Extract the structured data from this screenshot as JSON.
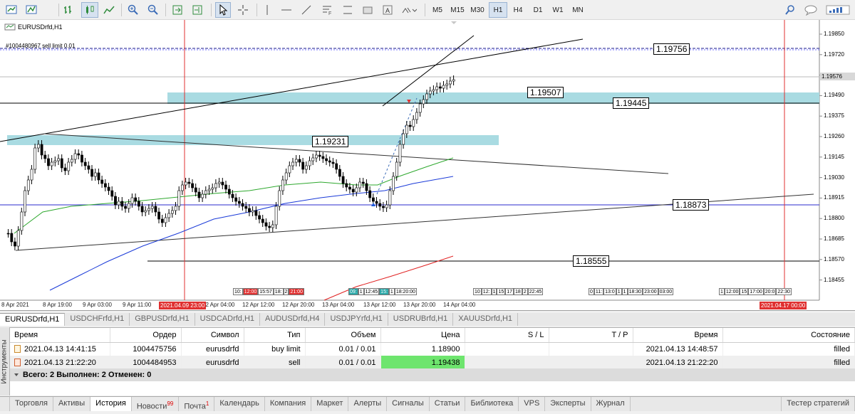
{
  "toolbar": {
    "timeframes": [
      "M5",
      "M15",
      "M30",
      "H1",
      "H4",
      "D1",
      "W1",
      "MN"
    ],
    "active_timeframe": "H1"
  },
  "chart": {
    "title": "EURUSDrfd,H1",
    "order_label": "#1004480967 sell limit 0.01",
    "price_ticks": [
      "1.19850",
      "1.19720",
      "1.19600",
      "1.19490",
      "1.19375",
      "1.19260",
      "1.19145",
      "1.19030",
      "1.18915",
      "1.18800",
      "1.18685",
      "1.18570",
      "1.18455"
    ],
    "current_price": "1.19576",
    "level_labels": [
      "1.19756",
      "1.19507",
      "1.19445",
      "1.19231",
      "1.18873",
      "1.18555"
    ],
    "time_ticks": [
      "8 Apr 2021",
      "8 Apr 19:00",
      "9 Apr 03:00",
      "9 Apr 11:00",
      "12 Apr 04:00",
      "12 Apr 12:00",
      "12 Apr 20:00",
      "13 Apr 04:00",
      "13 Apr 12:00",
      "13 Apr 20:00",
      "14 Apr 04:00"
    ],
    "vline_left_label": "2021.04.09 23:00",
    "vline_right_label": "2021.04.17 00:00",
    "mini_groups": [
      [
        "10:",
        "12:00",
        "15:57",
        "18:",
        "2",
        "21:00"
      ],
      [
        "09:",
        "1",
        "12:45",
        "15:",
        "1",
        "18:20:00"
      ],
      [
        "10",
        "12:",
        "1",
        "15",
        "17",
        "18",
        "2",
        "22:45"
      ],
      [
        "0",
        "11:",
        "13:0",
        "1",
        "1",
        "18:30",
        "23:00",
        "03:00"
      ],
      [
        "1",
        "12:00",
        "15",
        "17:00",
        "20:0",
        "22:30"
      ]
    ]
  },
  "symbol_tabs": [
    "EURUSDrfd,H1",
    "USDCHFrfd,H1",
    "GBPUSDrfd,H1",
    "USDCADrfd,H1",
    "AUDUSDrfd,H4",
    "USDJPYrfd,H1",
    "USDRUBrfd,H1",
    "XAUUSDrfd,H1"
  ],
  "panel": {
    "side_label": "Инструменты",
    "columns": [
      "Время",
      "Ордер",
      "Символ",
      "Тип",
      "Объем",
      "Цена",
      "S / L",
      "T / P",
      "Время",
      "Состояние"
    ],
    "rows": [
      [
        "2021.04.13 14:41:15",
        "1004475756",
        "eurusdrfd",
        "buy limit",
        "0.01 / 0.01",
        "1.18900",
        "",
        "",
        "2021.04.13 14:48:57",
        "filled"
      ],
      [
        "2021.04.13 21:22:20",
        "1004484953",
        "eurusdrfd",
        "sell",
        "0.01 / 0.01",
        "1.19438",
        "",
        "",
        "2021.04.13 21:22:20",
        "filled"
      ]
    ],
    "summary": "Всего: 2  Выполнен: 2  Отменен: 0"
  },
  "bottom_tabs": [
    {
      "label": "Торговля",
      "badge": ""
    },
    {
      "label": "Активы",
      "badge": ""
    },
    {
      "label": "История",
      "badge": ""
    },
    {
      "label": "Новости",
      "badge": "99"
    },
    {
      "label": "Почта",
      "badge": "1"
    },
    {
      "label": "Календарь",
      "badge": ""
    },
    {
      "label": "Компания",
      "badge": ""
    },
    {
      "label": "Маркет",
      "badge": ""
    },
    {
      "label": "Алерты",
      "badge": ""
    },
    {
      "label": "Сигналы",
      "badge": ""
    },
    {
      "label": "Статьи",
      "badge": ""
    },
    {
      "label": "Библиотека",
      "badge": ""
    },
    {
      "label": "VPS",
      "badge": ""
    },
    {
      "label": "Эксперты",
      "badge": ""
    },
    {
      "label": "Журнал",
      "badge": ""
    }
  ],
  "active_bottom_tab": "История",
  "strategy_tester_label": "Тестер стратегий"
}
